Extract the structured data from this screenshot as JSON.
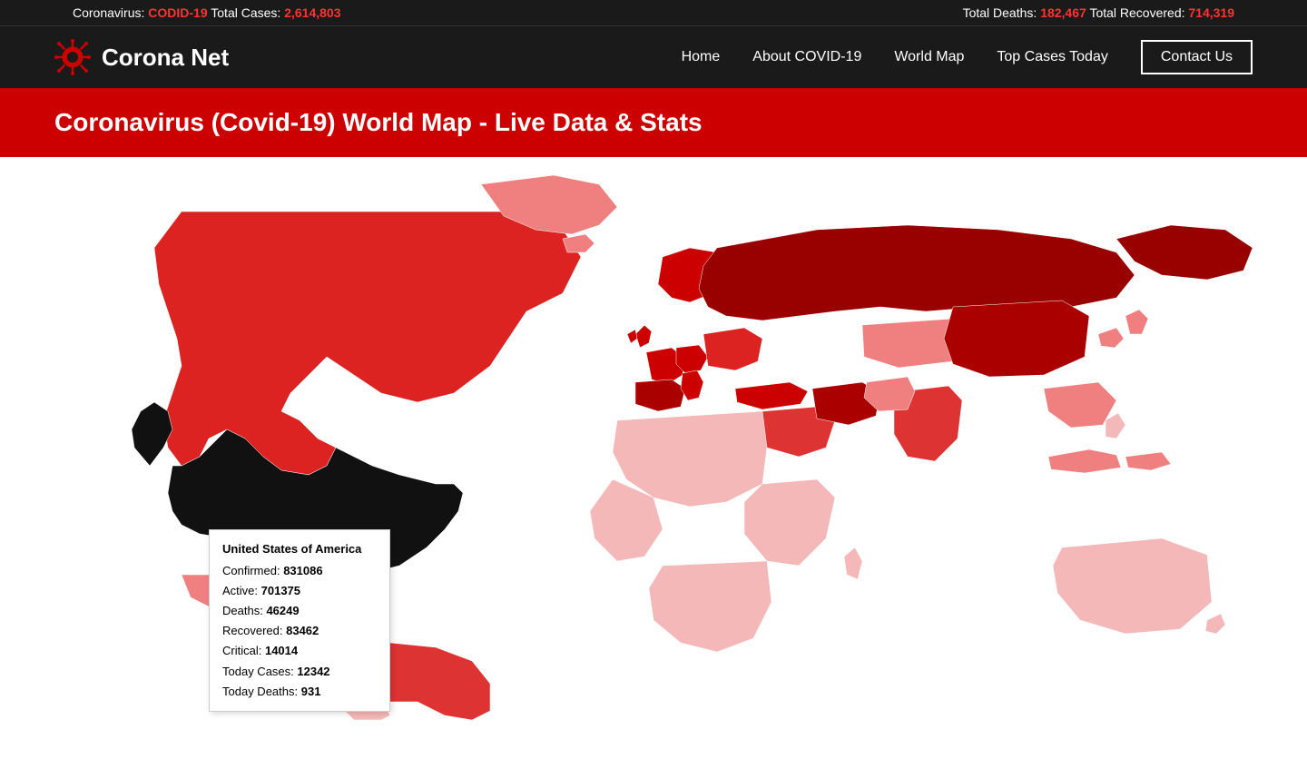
{
  "ticker": {
    "left_label": "Coronavirus:",
    "left_tag": "CODID-19",
    "left_suffix": "Total Cases:",
    "total_cases": "2,614,803",
    "right_deaths_label": "Total Deaths:",
    "total_deaths": "182,467",
    "right_recovered_label": "Total Recovered:",
    "total_recovered": "714,319"
  },
  "navbar": {
    "logo_text": "Corona Net",
    "nav_home": "Home",
    "nav_about": "About COVID-19",
    "nav_worldmap": "World Map",
    "nav_topcases": "Top Cases Today",
    "nav_contact": "Contact Us"
  },
  "banner": {
    "title": "Coronavirus (Covid-19) World Map - Live Data & Stats"
  },
  "tooltip": {
    "country": "United States of America",
    "confirmed_label": "Confirmed:",
    "confirmed_value": "831086",
    "active_label": "Active:",
    "active_value": "701375",
    "deaths_label": "Deaths:",
    "deaths_value": "46249",
    "recovered_label": "Recovered:",
    "recovered_value": "83462",
    "critical_label": "Critical:",
    "critical_value": "14014",
    "today_cases_label": "Today Cases:",
    "today_cases_value": "12342",
    "today_deaths_label": "Today Deaths:",
    "today_deaths_value": "931"
  },
  "colors": {
    "dark_red": "#cc0000",
    "medium_red": "#e03030",
    "light_red": "#f08080",
    "very_light_red": "#f5b8b8",
    "black": "#111111",
    "usa_color": "#111111",
    "russia_color": "#990000",
    "europe_dark": "#cc0000",
    "canada_color": "#dd2222",
    "china_color": "#aa0000",
    "brazil_color": "#dd3333",
    "india_color": "#dd3333"
  }
}
